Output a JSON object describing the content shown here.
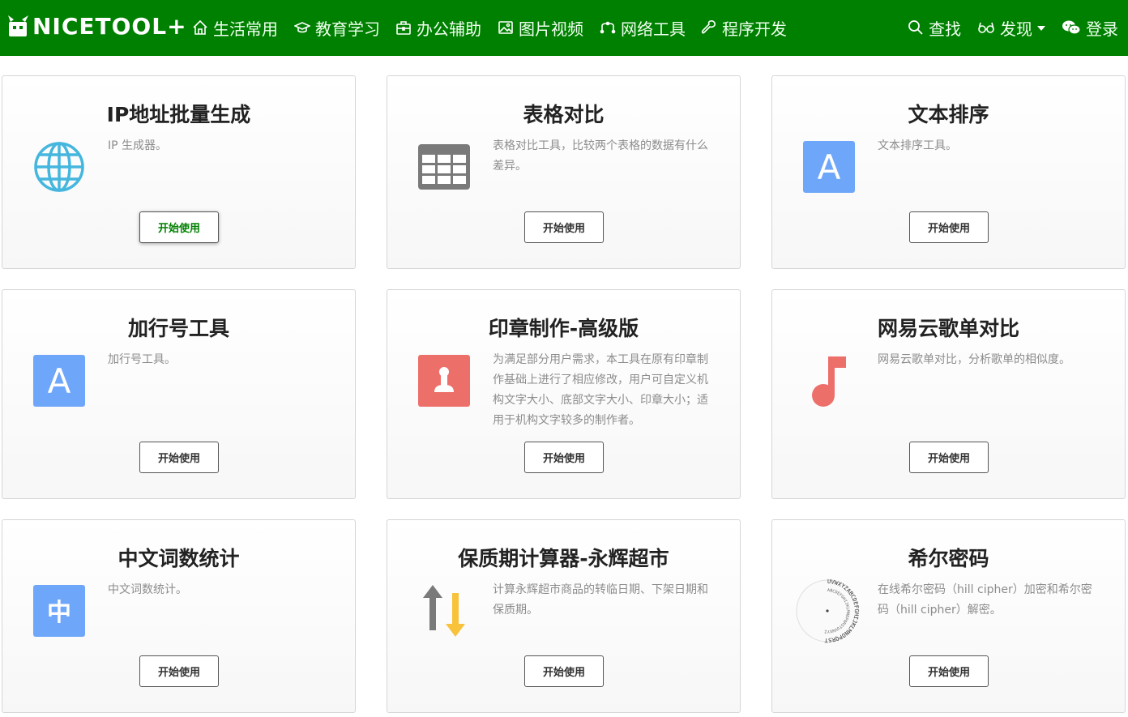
{
  "brand": {
    "name": "NICETOOL+"
  },
  "nav": {
    "items": [
      {
        "label": "生活常用",
        "icon": "home-icon"
      },
      {
        "label": "教育学习",
        "icon": "graduation-cap-icon"
      },
      {
        "label": "办公辅助",
        "icon": "briefcase-icon"
      },
      {
        "label": "图片视频",
        "icon": "image-icon"
      },
      {
        "label": "网络工具",
        "icon": "network-icon"
      },
      {
        "label": "程序开发",
        "icon": "wrench-icon"
      }
    ],
    "search_label": "查找",
    "discover_label": "发现",
    "login_label": "登录"
  },
  "cards": [
    {
      "title": "IP地址批量生成",
      "desc": "IP 生成器。",
      "button": "开始使用",
      "icon": "globe-icon"
    },
    {
      "title": "表格对比",
      "desc": "表格对比工具，比较两个表格的数据有什么差异。",
      "button": "开始使用",
      "icon": "table-icon"
    },
    {
      "title": "文本排序",
      "desc": "文本排序工具。",
      "button": "开始使用",
      "icon": "letter-a-icon"
    },
    {
      "title": "加行号工具",
      "desc": "加行号工具。",
      "button": "开始使用",
      "icon": "letter-a-icon"
    },
    {
      "title": "印章制作-高级版",
      "desc": "为满足部分用户需求，本工具在原有印章制作基础上进行了相应修改，用户可自定义机构文字大小、底部文字大小、印章大小；适用于机构文字较多的制作者。",
      "button": "开始使用",
      "icon": "stamp-icon"
    },
    {
      "title": "网易云歌单对比",
      "desc": "网易云歌单对比，分析歌单的相似度。",
      "button": "开始使用",
      "icon": "music-note-icon"
    },
    {
      "title": "中文词数统计",
      "desc": "中文词数统计。",
      "button": "开始使用",
      "icon": "chinese-char-icon"
    },
    {
      "title": "保质期计算器-永辉超市",
      "desc": "计算永辉超市商品的转临日期、下架日期和保质期。",
      "button": "开始使用",
      "icon": "sort-arrows-icon"
    },
    {
      "title": "希尔密码",
      "desc": "在线希尔密码（hill cipher）加密和希尔密码（hill cipher）解密。",
      "button": "开始使用",
      "icon": "cipher-wheel-icon"
    }
  ],
  "icon_text": {
    "letter_a": "A",
    "chinese_char": "中",
    "cipher_outer": "UVWXYZABCDEFGHIJKLMNOPQRST",
    "cipher_inner": "ABCDEFGHIJKLMNOPQRSTUVWXYZ"
  },
  "colors": {
    "navbar": "#008000",
    "accent_blue": "#6ea6f9",
    "accent_red": "#ed6f6a",
    "accent_yellow": "#f8c23a",
    "globe": "#45b6dd",
    "table_gray": "#7a7a7a"
  }
}
